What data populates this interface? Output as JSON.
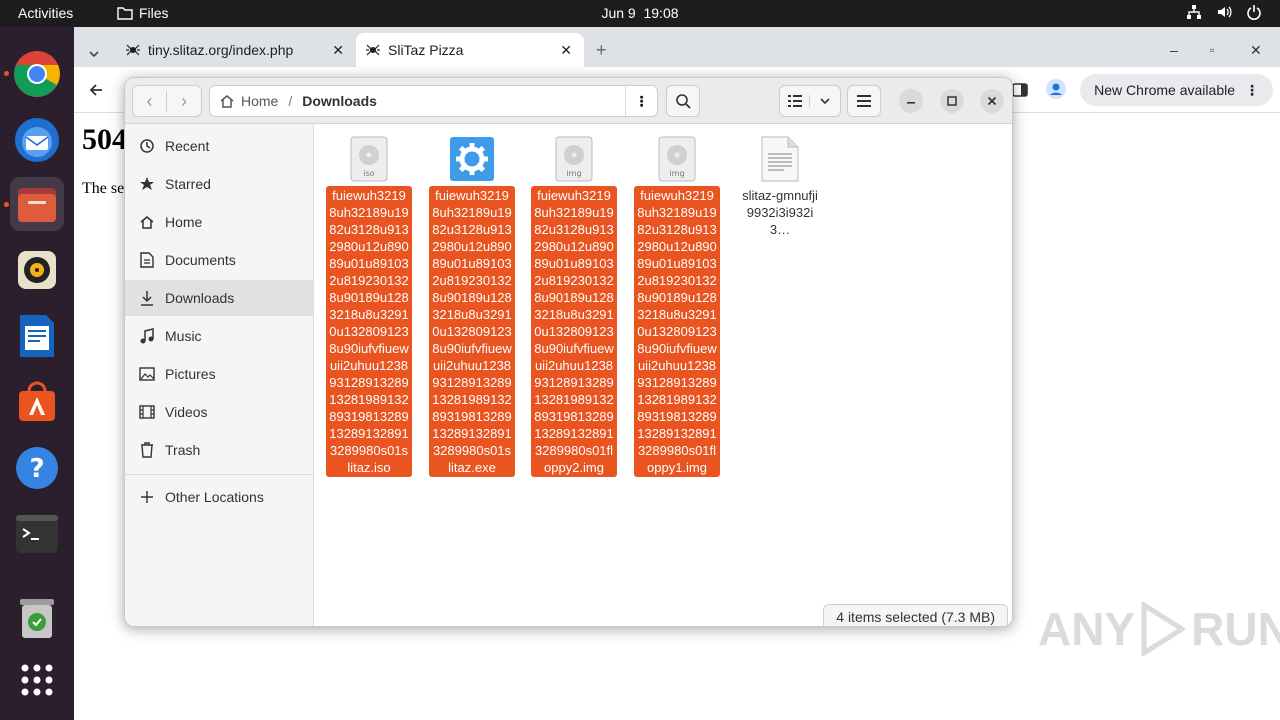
{
  "topbar": {
    "activities": "Activities",
    "app_name": "Files",
    "date": "Jun 9",
    "time": "19:08"
  },
  "dock": {
    "apps": [
      "Google Chrome",
      "Thunderbird",
      "Files",
      "Rhythmbox",
      "LibreOffice Writer",
      "Ubuntu Software",
      "Help",
      "Terminal",
      "Trash",
      "Show Applications"
    ]
  },
  "browser": {
    "tabs": [
      {
        "label": "tiny.slitaz.org/index.php"
      },
      {
        "label": "SliTaz Pizza"
      }
    ],
    "update_label": "New Chrome available",
    "page_heading": "504",
    "page_text": "The se"
  },
  "files_window": {
    "path": [
      "Home",
      "Downloads"
    ],
    "sidebar": [
      {
        "label": "Recent",
        "icon": "clock-icon"
      },
      {
        "label": "Starred",
        "icon": "star-icon"
      },
      {
        "label": "Home",
        "icon": "home-icon"
      },
      {
        "label": "Documents",
        "icon": "document-icon"
      },
      {
        "label": "Downloads",
        "icon": "download-icon"
      },
      {
        "label": "Music",
        "icon": "music-icon"
      },
      {
        "label": "Pictures",
        "icon": "picture-icon"
      },
      {
        "label": "Videos",
        "icon": "video-icon"
      },
      {
        "label": "Trash",
        "icon": "trash-icon"
      },
      {
        "label": "Other Locations",
        "icon": "plus-icon"
      }
    ],
    "selected_sidebar": "Downloads",
    "files": [
      {
        "name": "fuiewuh32198uh32189u1982u3128u9132980u12u89089u01u891032u8192301328u90189u1283218u8u32910u1328091238u90iufvfiuewuii2uhuu1238931289132891328198913289319813289132891328913289980s01slitaz.iso",
        "icon_label": "iso",
        "selected": true
      },
      {
        "name": "fuiewuh32198uh32189u1982u3128u9132980u12u89089u01u891032u8192301328u90189u1283218u8u32910u1328091238u90iufvfiuewuii2uhuu1238931289132891328198913289319813289132891328913289980s01slitaz.exe",
        "icon_label": "",
        "selected": true
      },
      {
        "name": "fuiewuh32198uh32189u1982u3128u9132980u12u89089u01u891032u8192301328u90189u1283218u8u32910u1328091238u90iufvfiuewuii2uhuu1238931289132891328198913289319813289132891328913289980s01floppy2.img",
        "icon_label": "img",
        "selected": true
      },
      {
        "name": "fuiewuh32198uh32189u1982u3128u9132980u12u89089u01u891032u8192301328u90189u1283218u8u32910u1328091238u90iufvfiuewuii2uhuu1238931289132891328198913289319813289132891328913289980s01floppy1.img",
        "icon_label": "img",
        "selected": true
      },
      {
        "name": "slitaz-gmnufji9932i3i932i3…",
        "icon_label": "",
        "selected": false
      }
    ],
    "status": "4 items selected  (7.3 MB)"
  },
  "watermark": {
    "text": "ANY",
    "text2": "RUN"
  },
  "colors": {
    "accent": "#e95420",
    "dock_bg": "#2b1f2e",
    "topbar_bg": "#1d1d1d"
  }
}
